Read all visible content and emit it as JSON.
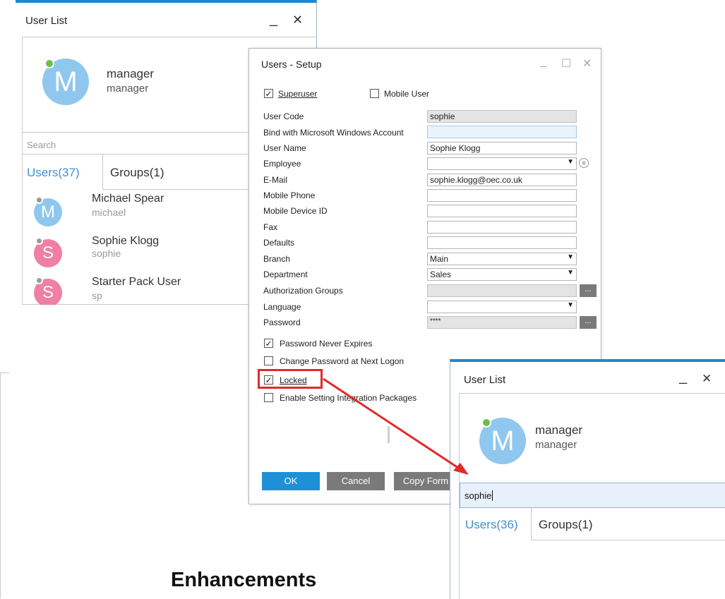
{
  "user_list_left": {
    "title": "User List",
    "minimize": "_",
    "close": "✕",
    "current_user": {
      "initial": "M",
      "name": "manager",
      "code": "manager"
    },
    "search_placeholder": "Search",
    "tabs": {
      "users": "Users(37)",
      "groups": "Groups(1)"
    },
    "users": [
      {
        "initial": "M",
        "name": "Michael Spear",
        "code": "michael",
        "color": "#8fc7ef"
      },
      {
        "initial": "S",
        "name": "Sophie Klogg",
        "code": "sophie",
        "color": "#ef7fa3"
      },
      {
        "initial": "S",
        "name": "Starter Pack User",
        "code": "sp",
        "color": "#ef7fa3"
      }
    ]
  },
  "setup": {
    "title": "Users - Setup",
    "window_controls": {
      "minimize": "_",
      "maximize": "☐",
      "close": "✕"
    },
    "superuser": {
      "label": "Superuser",
      "checked": true
    },
    "mobile_user": {
      "label": "Mobile User",
      "checked": false
    },
    "fields": {
      "user_code": {
        "label": "User Code",
        "value": "sophie"
      },
      "bind_windows": {
        "label": "Bind with Microsoft Windows Account",
        "value": ""
      },
      "user_name": {
        "label": "User Name",
        "value": "Sophie Klogg"
      },
      "employee": {
        "label": "Employee",
        "value": ""
      },
      "email": {
        "label": "E-Mail",
        "value": "sophie.klogg@oec.co.uk"
      },
      "mobile_phone": {
        "label": "Mobile Phone",
        "value": ""
      },
      "mobile_device": {
        "label": "Mobile Device ID",
        "value": ""
      },
      "fax": {
        "label": "Fax",
        "value": ""
      },
      "defaults": {
        "label": "Defaults",
        "value": ""
      },
      "branch": {
        "label": "Branch",
        "value": "Main"
      },
      "department": {
        "label": "Department",
        "value": "Sales"
      },
      "auth_groups": {
        "label": "Authorization Groups",
        "value": ""
      },
      "language": {
        "label": "Language",
        "value": ""
      },
      "password": {
        "label": "Password",
        "value": "****"
      }
    },
    "checkboxes": {
      "password_never_expires": {
        "label": "Password Never Expires",
        "checked": true
      },
      "change_password": {
        "label": "Change Password at Next Logon",
        "checked": false
      },
      "locked": {
        "label": "Locked",
        "checked": true
      },
      "enable_integration": {
        "label": "Enable Setting Integration Packages",
        "checked": false
      }
    },
    "buttons": {
      "ok": "OK",
      "cancel": "Cancel",
      "copy_form": "Copy Form"
    },
    "dots": "..."
  },
  "user_list_right": {
    "title": "User List",
    "minimize": "_",
    "close": "✕",
    "current_user": {
      "initial": "M",
      "name": "manager",
      "code": "manager"
    },
    "search_value": "sophie",
    "tabs": {
      "users": "Users(36)",
      "groups": "Groups(1)"
    }
  },
  "heading": "Enhancements",
  "colors": {
    "accent_blue": "#1a8ad4",
    "ok_button": "#1e91d6",
    "grey_button": "#7a7a7a",
    "annotation_red": "#e2292b"
  }
}
